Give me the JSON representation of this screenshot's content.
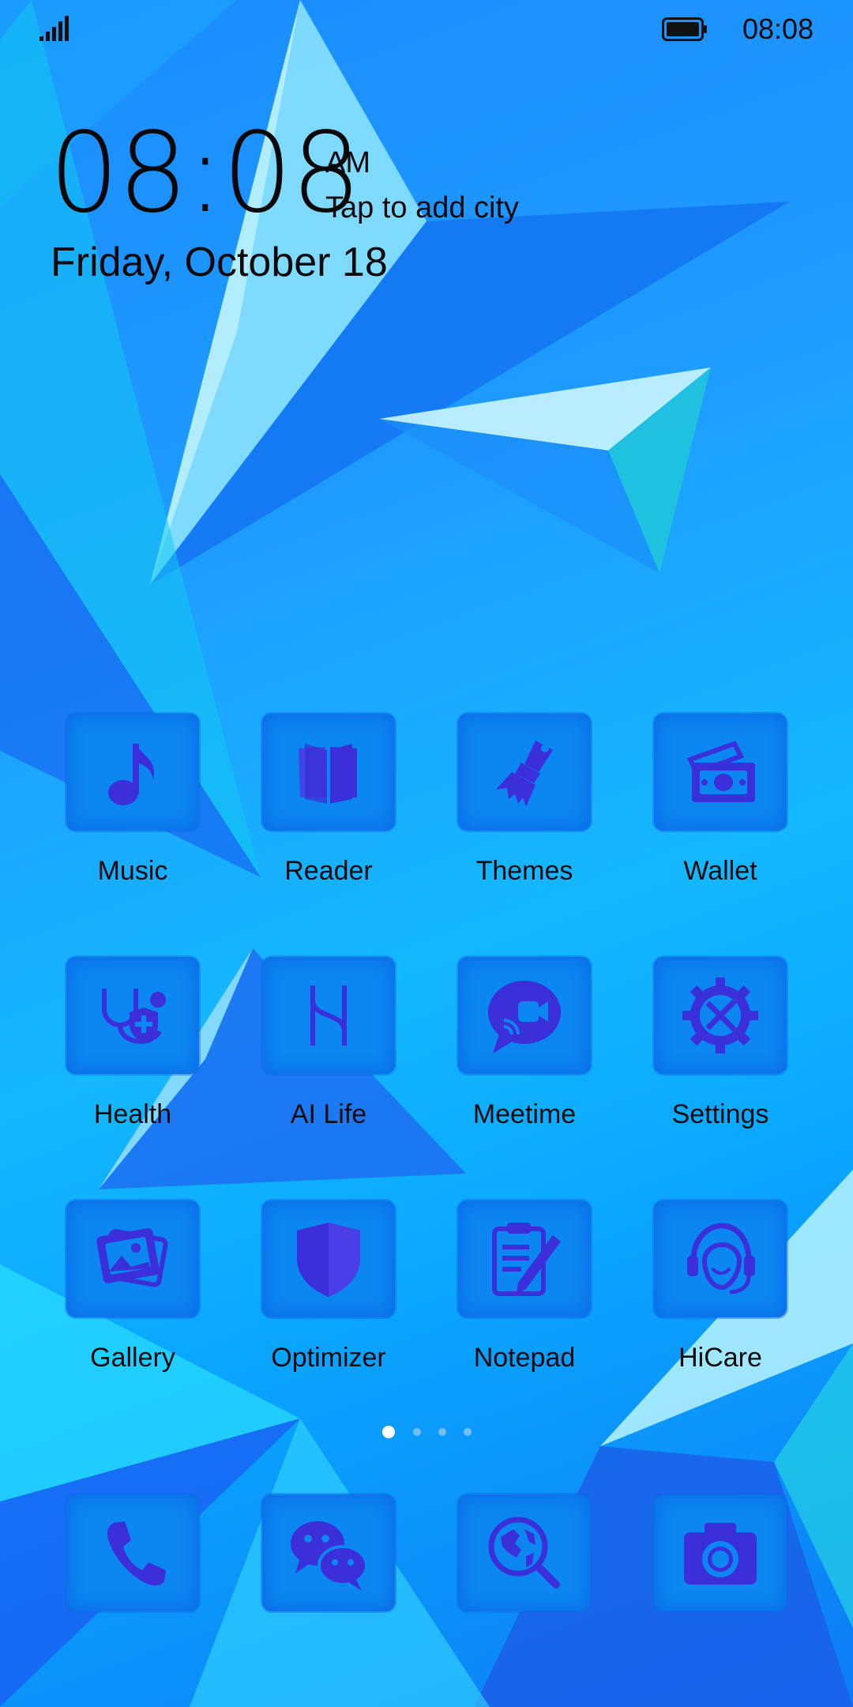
{
  "status_bar": {
    "time": "08:08",
    "icons": [
      "signal-icon",
      "battery-icon"
    ]
  },
  "clock_widget": {
    "time": "08:08",
    "ampm": "AM",
    "city_prompt": "Tap to add city",
    "date": "Friday, October 18"
  },
  "apps": [
    {
      "label": "Music",
      "icon": "music-note-icon"
    },
    {
      "label": "Reader",
      "icon": "book-icon"
    },
    {
      "label": "Themes",
      "icon": "paintbrush-icon"
    },
    {
      "label": "Wallet",
      "icon": "wallet-icon"
    },
    {
      "label": "Health",
      "icon": "stethoscope-shield-icon"
    },
    {
      "label": "AI Life",
      "icon": "ai-life-icon"
    },
    {
      "label": "Meetime",
      "icon": "video-chat-icon"
    },
    {
      "label": "Settings",
      "icon": "gear-tools-icon"
    },
    {
      "label": "Gallery",
      "icon": "photos-icon"
    },
    {
      "label": "Optimizer",
      "icon": "shield-icon"
    },
    {
      "label": "Notepad",
      "icon": "clipboard-pencil-icon"
    },
    {
      "label": "HiCare",
      "icon": "headset-icon"
    }
  ],
  "page_indicator": {
    "pages": 4,
    "current": 1
  },
  "dock": [
    {
      "icon": "phone-icon"
    },
    {
      "icon": "chat-bubbles-icon"
    },
    {
      "icon": "globe-search-icon"
    },
    {
      "icon": "camera-icon"
    }
  ],
  "colors": {
    "icon_glyph": "#3a2fd8",
    "tile": "#0c86f0",
    "wallpaper": "#14b8ff"
  }
}
